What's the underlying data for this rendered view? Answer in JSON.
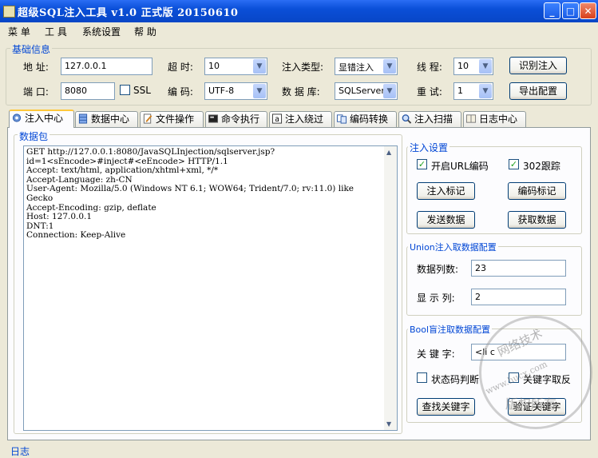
{
  "window": {
    "title": "超级SQL注入工具 v1.0 正式版 20150610",
    "minimize": "_",
    "maximize": "□",
    "close": "✕"
  },
  "menu": [
    "菜 单",
    "工 具",
    "系统设置",
    "帮 助"
  ],
  "basic_info": {
    "legend": "基础信息",
    "address_label": "地 址:",
    "address_value": "127.0.0.1",
    "port_label": "端 口:",
    "port_value": "8080",
    "ssl_label": "SSL",
    "ssl_checked": false,
    "timeout_label": "超 时:",
    "timeout_value": "10",
    "encoding_label": "编 码:",
    "encoding_value": "UTF-8",
    "inject_type_label": "注入类型:",
    "inject_type_value": "显错注入",
    "database_label": "数 据 库:",
    "database_value": "SQLServer",
    "threads_label": "线 程:",
    "threads_value": "10",
    "retry_label": "重 试:",
    "retry_value": "1",
    "identify_button": "识别注入",
    "export_button": "导出配置"
  },
  "tabs": [
    {
      "label": "注入中心",
      "icon": "gear-icon",
      "active": true
    },
    {
      "label": "数据中心",
      "icon": "database-icon",
      "active": false
    },
    {
      "label": "文件操作",
      "icon": "file-edit-icon",
      "active": false
    },
    {
      "label": "命令执行",
      "icon": "terminal-icon",
      "active": false
    },
    {
      "label": "注入绕过",
      "icon": "bypass-icon",
      "active": false
    },
    {
      "label": "编码转换",
      "icon": "convert-icon",
      "active": false
    },
    {
      "label": "注入扫描",
      "icon": "magnifier-icon",
      "active": false
    },
    {
      "label": "日志中心",
      "icon": "book-icon",
      "active": false
    }
  ],
  "packet": {
    "legend": "数据包",
    "content": "GET http://127.0.0.1:8080/JavaSQLInjection/sqlserver.jsp?\nid=1<sEncode>#inject#<eEncode> HTTP/1.1\nAccept: text/html, application/xhtml+xml, */*\nAccept-Language: zh-CN\nUser-Agent: Mozilla/5.0 (Windows NT 6.1; WOW64; Trident/7.0; rv:11.0) like\nGecko\nAccept-Encoding: gzip, deflate\nHost: 127.0.0.1\nDNT:1\nConnection: Keep-Alive"
  },
  "inject_settings": {
    "legend": "注入设置",
    "url_encode_label": "开启URL编码",
    "url_encode_checked": true,
    "follow302_label": "302跟踪",
    "follow302_checked": true,
    "mark_inject_button": "注入标记",
    "mark_encode_button": "编码标记",
    "send_button": "发送数据",
    "fetch_button": "获取数据"
  },
  "union_config": {
    "legend": "Union注入取数据配置",
    "columns_label": "数据列数:",
    "columns_value": "23",
    "display_label": "显 示 列:",
    "display_value": "2"
  },
  "bool_config": {
    "legend": "Bool盲注取数据配置",
    "keyword_label": "关 键 字:",
    "keyword_value": "<li c",
    "status_code_label": "状态码判断",
    "status_code_checked": false,
    "keyword_invert_label": "关键字取反",
    "keyword_invert_checked": false,
    "find_keyword_button": "查找关键字",
    "verify_keyword_button": "验证关键字"
  },
  "log": {
    "legend": "日志"
  },
  "watermark": {
    "line1": "网络技术",
    "line2": "www.hucx.com",
    "line3": "版权所有"
  }
}
